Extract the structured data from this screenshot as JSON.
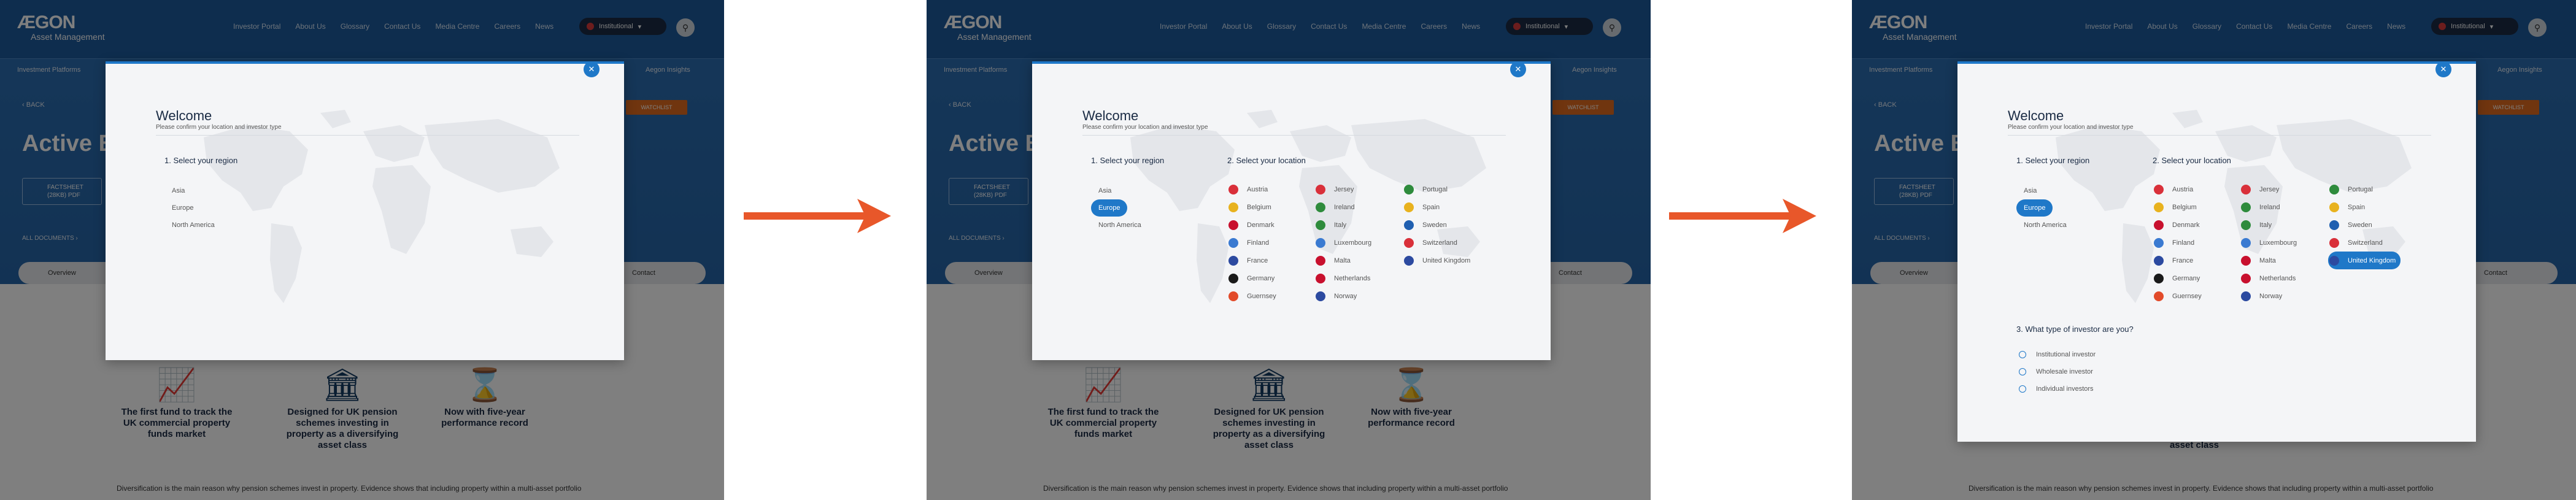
{
  "site": {
    "logo_mark": "ÆGON",
    "logo_sub": "Asset Management",
    "nav": [
      "Investor Portal",
      "About Us",
      "Glossary",
      "Contact Us",
      "Media Centre",
      "Careers",
      "News"
    ],
    "investor_pill": "Institutional",
    "sub_left": "Investment Platforms",
    "sub_right": "Aegon Insights",
    "back": "BACK",
    "hero_title": "Active B",
    "factsheet": "FACTSHEET (28KB) PDF",
    "all_documents": "ALL DOCUMENTS",
    "watchlist": "WATCHLIST",
    "tab_overview": "Overview",
    "tab_contact": "Contact",
    "features": [
      "The first fund to track the UK commercial property funds market",
      "Designed for UK pension schemes investing in property as a diversifying asset class",
      "Now with five-year performance record"
    ],
    "bottom_note": "Diversification is the main reason why pension schemes invest in property. Evidence shows that including property within a multi-asset portfolio"
  },
  "modal": {
    "title": "Welcome",
    "subtitle": "Please confirm your location and investor type",
    "region_title": "1. Select your region",
    "regions": [
      "Asia",
      "Europe",
      "North America"
    ],
    "location_title": "2. Select your location",
    "locations_col1": [
      "Austria",
      "Belgium",
      "Denmark",
      "Finland",
      "France",
      "Germany",
      "Guernsey"
    ],
    "locations_col2": [
      "Jersey",
      "Ireland",
      "Italy",
      "Luxembourg",
      "Malta",
      "Netherlands",
      "Norway"
    ],
    "locations_col3": [
      "Portugal",
      "Spain",
      "Sweden",
      "Switzerland",
      "United Kingdom"
    ],
    "flag_colors_col1": [
      "#d9303a",
      "#e8b21e",
      "#c8102e",
      "#3a7ad1",
      "#2c4aa0",
      "#1a1a1a",
      "#e24b2a"
    ],
    "flag_colors_col2": [
      "#d9303a",
      "#2e8b3c",
      "#2e8b3c",
      "#3a7ad1",
      "#c8102e",
      "#c8102e",
      "#2c4aa0"
    ],
    "flag_colors_col3": [
      "#2e8b3c",
      "#e8b21e",
      "#1f5fb0",
      "#d9303a",
      "#2c4aa0"
    ],
    "investor_title": "3. What type of investor are you?",
    "investor_types": [
      "Institutional investor",
      "Wholesale investor",
      "Individual investors"
    ],
    "close_glyph": "✕"
  },
  "colors": {
    "accent": "#1f78c8",
    "header_blue": "#1d5a9c",
    "arrow": "#e8572a"
  }
}
